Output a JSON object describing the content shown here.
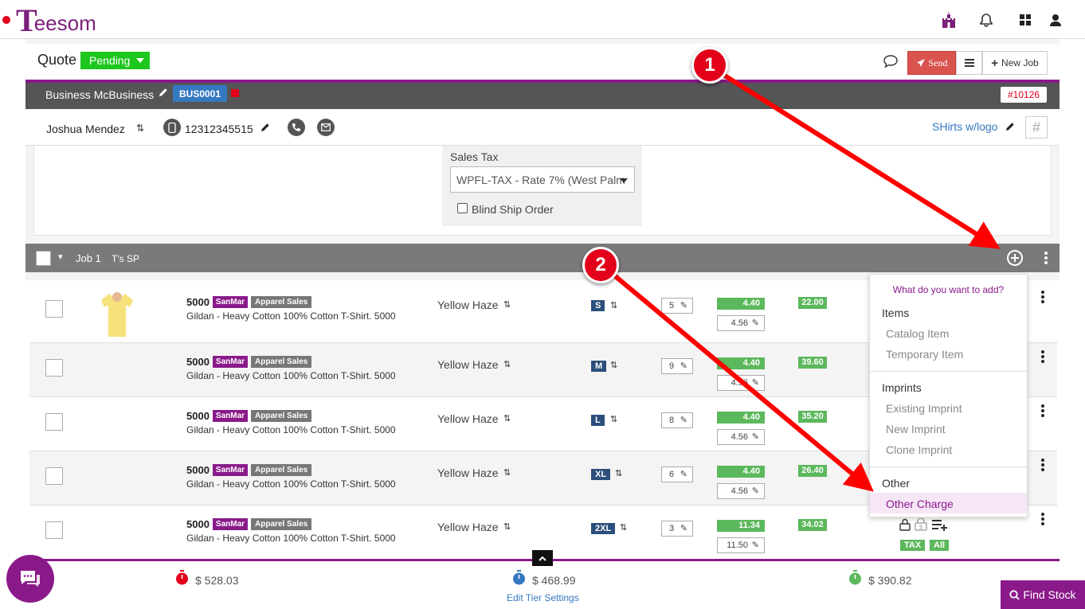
{
  "brand": {
    "logo_letter": "T",
    "logo_rest": "eesom"
  },
  "header": {
    "title": "Quote",
    "status": "Pending",
    "send_label": "Send",
    "new_job_label": "New Job"
  },
  "business": {
    "name": "Business McBusiness",
    "code": "BUS0001",
    "quote_number": "#10126"
  },
  "contact": {
    "name": "Joshua Mendez",
    "phone": "12312345515",
    "job_name": "SHirts w/logo"
  },
  "tax": {
    "label": "Sales Tax",
    "value": "WPFL-TAX - Rate 7% (West Palm",
    "blind_ship_label": "Blind Ship Order"
  },
  "job": {
    "label": "Job 1",
    "name": "T's SP"
  },
  "rows": [
    {
      "sku": "5000",
      "supplier": "SanMar",
      "category": "Apparel Sales",
      "desc": "Gildan - Heavy Cotton 100% Cotton T-Shirt. 5000",
      "color": "Yellow Haze",
      "size": "S",
      "qty": "5",
      "price": "4.40",
      "price2": "4.56",
      "total": "22.00"
    },
    {
      "sku": "5000",
      "supplier": "SanMar",
      "category": "Apparel Sales",
      "desc": "Gildan - Heavy Cotton 100% Cotton T-Shirt. 5000",
      "color": "Yellow Haze",
      "size": "M",
      "qty": "9",
      "price": "4.40",
      "price2": "4.56",
      "total": "39.60"
    },
    {
      "sku": "5000",
      "supplier": "SanMar",
      "category": "Apparel Sales",
      "desc": "Gildan - Heavy Cotton 100% Cotton T-Shirt. 5000",
      "color": "Yellow Haze",
      "size": "L",
      "qty": "8",
      "price": "4.40",
      "price2": "4.56",
      "total": "35.20"
    },
    {
      "sku": "5000",
      "supplier": "SanMar",
      "category": "Apparel Sales",
      "desc": "Gildan - Heavy Cotton 100% Cotton T-Shirt. 5000",
      "color": "Yellow Haze",
      "size": "XL",
      "qty": "6",
      "price": "4.40",
      "price2": "4.56",
      "total": "26.40"
    },
    {
      "sku": "5000",
      "supplier": "SanMar",
      "category": "Apparel Sales",
      "desc": "Gildan - Heavy Cotton 100% Cotton T-Shirt. 5000",
      "color": "Yellow Haze",
      "size": "2XL",
      "qty": "3",
      "price": "11.34",
      "price2": "11.50",
      "total": "34.02"
    }
  ],
  "row_tags": {
    "tax": "TAX",
    "all": "All"
  },
  "add_menu": {
    "title": "What do you want to add?",
    "items_header": "Items",
    "catalog": "Catalog Item",
    "temporary": "Temporary Item",
    "imprints_header": "Imprints",
    "existing_imprint": "Existing Imprint",
    "new_imprint": "New Imprint",
    "clone_imprint": "Clone Imprint",
    "other_header": "Other",
    "other_charge": "Other Charge"
  },
  "footer": {
    "total_red": "$ 528.03",
    "total_blue": "$ 468.99",
    "total_green": "$ 390.82",
    "edit_tier": "Edit Tier Settings",
    "find_stock": "Find Stock"
  },
  "callouts": {
    "one": "1",
    "two": "2"
  },
  "colors": {
    "brand": "#8a1a8a",
    "accent_red": "#e2001a",
    "green": "#5cb85c",
    "status_green": "#1ec71e"
  }
}
